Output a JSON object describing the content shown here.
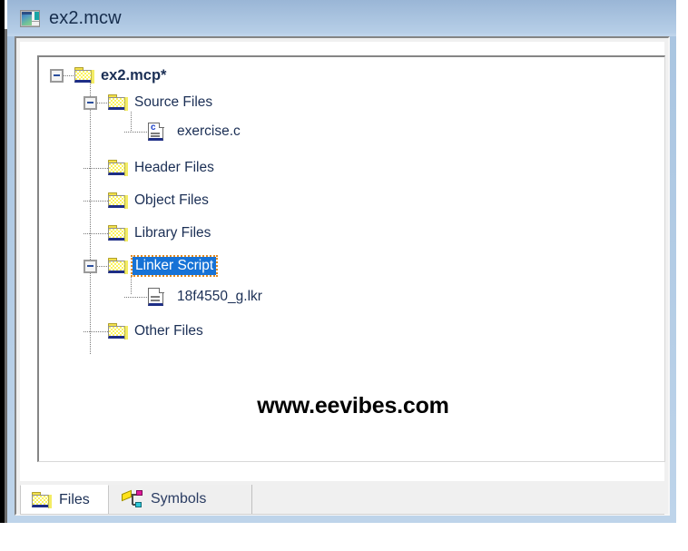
{
  "window": {
    "title": "ex2.mcw",
    "icon": "mdi-document-icon"
  },
  "tree": {
    "nodes": [
      {
        "id": "root",
        "label": "ex2.mcp*",
        "icon": "folder-icon",
        "depth": 0,
        "expanded": true,
        "bold": true,
        "selected": false
      },
      {
        "id": "source-files",
        "label": "Source Files",
        "icon": "folder-icon",
        "depth": 1,
        "expanded": true,
        "bold": false,
        "selected": false
      },
      {
        "id": "exercise-c",
        "label": "exercise.c",
        "icon": "c-file-icon",
        "depth": 2,
        "expanded": null,
        "bold": false,
        "selected": false
      },
      {
        "id": "header-files",
        "label": "Header Files",
        "icon": "folder-icon",
        "depth": 1,
        "expanded": null,
        "bold": false,
        "selected": false
      },
      {
        "id": "object-files",
        "label": "Object Files",
        "icon": "folder-icon",
        "depth": 1,
        "expanded": null,
        "bold": false,
        "selected": false
      },
      {
        "id": "library-files",
        "label": "Library Files",
        "icon": "folder-icon",
        "depth": 1,
        "expanded": null,
        "bold": false,
        "selected": false
      },
      {
        "id": "linker-script",
        "label": "Linker Script",
        "icon": "folder-icon",
        "depth": 1,
        "expanded": true,
        "bold": false,
        "selected": true
      },
      {
        "id": "lkr-file",
        "label": "18f4550_g.lkr",
        "icon": "generic-file-icon",
        "depth": 2,
        "expanded": null,
        "bold": false,
        "selected": false
      },
      {
        "id": "other-files",
        "label": "Other Files",
        "icon": "folder-icon",
        "depth": 1,
        "expanded": null,
        "bold": false,
        "selected": false
      }
    ]
  },
  "watermark": {
    "text": "www.eevibes.com"
  },
  "tabs": {
    "items": [
      {
        "id": "files",
        "label": "Files",
        "icon": "folder-icon",
        "active": true
      },
      {
        "id": "symbols",
        "label": "Symbols",
        "icon": "symbols-icon",
        "active": false
      }
    ]
  },
  "colors": {
    "title_bar_top": "#9ab6d6",
    "title_bar_bottom": "#c2d6ec",
    "selection_blue": "#1672d6",
    "focus_outline": "#e08a22",
    "folder_yellow": "#fbf35f",
    "folder_shadow": "#1e2e86",
    "text": "#1b2f55"
  }
}
